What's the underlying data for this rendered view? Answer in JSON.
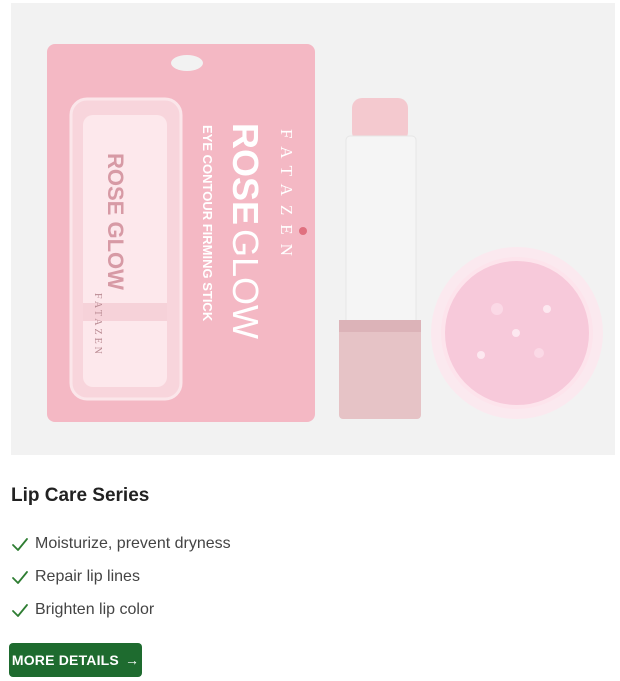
{
  "product": {
    "image": {
      "package_brand": "FATAZEN",
      "package_title_line1": "ROSE",
      "package_title_line2": "GLOW",
      "package_subtitle": "EYE CONTOUR FIRMING STICK",
      "tube_brand": "FATAZEN",
      "tube_title": "ROSE GLOW",
      "colors": {
        "background": "#f2f2f2",
        "card_pink": "#f4b8c4",
        "stick_pink": "#e6c3c6",
        "balm_pink": "#f7c9da"
      }
    },
    "title": "Lip Care Series",
    "features": [
      {
        "icon": "check-icon",
        "text": "Moisturize, prevent dryness"
      },
      {
        "icon": "check-icon",
        "text": "Repair lip lines"
      },
      {
        "icon": "check-icon",
        "text": "Brighten lip color"
      }
    ],
    "cta": {
      "label": "MORE DETAILS",
      "icon": "arrow-right-icon",
      "arrow": "→",
      "color": "#1e6b2f"
    },
    "check_color": "#2e7d32"
  }
}
